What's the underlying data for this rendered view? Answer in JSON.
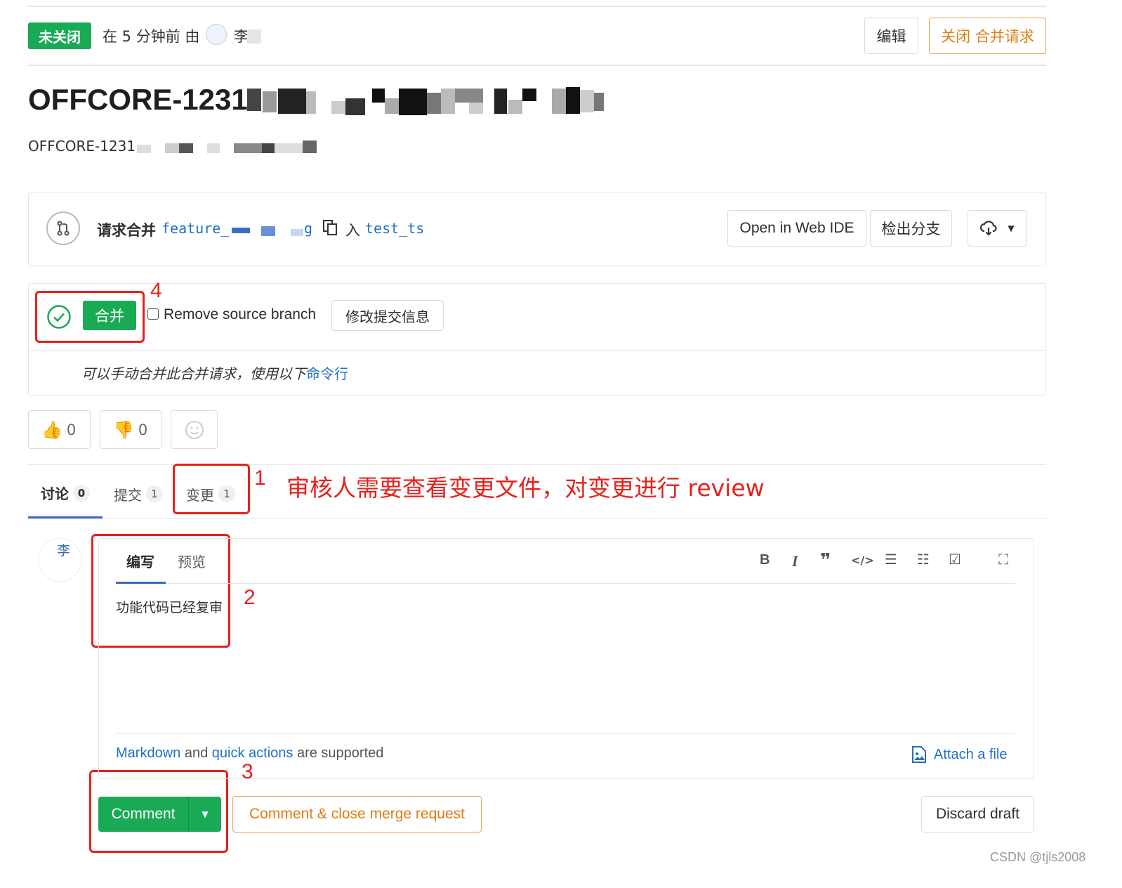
{
  "header": {
    "status_badge": "未关闭",
    "meta_text": "在 5 分钟前 由",
    "author_initial": "李",
    "edit_button": "编辑",
    "close_button": "关闭 合并请求"
  },
  "title": {
    "prefix": "OFFCORE-1231",
    "description_prefix": "OFFCORE-1231"
  },
  "branch_box": {
    "label": "请求合并",
    "source_branch_part": "feature_",
    "source_branch_end": "g",
    "into": "入",
    "target_branch": "test_ts",
    "web_ide_button": "Open in Web IDE",
    "checkout_button": "检出分支"
  },
  "merge_widget": {
    "merge_button": "合并",
    "remove_source_label": "Remove source branch",
    "modify_commit_button": "修改提交信息",
    "manual_text": "可以手动合并此合并请求，使用以下",
    "command_link": "命令行"
  },
  "reactions": {
    "thumbs_up_count": "0",
    "thumbs_down_count": "0"
  },
  "tabs": [
    {
      "label": "讨论",
      "count": "0"
    },
    {
      "label": "提交",
      "count": "1"
    },
    {
      "label": "变更",
      "count": "1"
    }
  ],
  "annotations": {
    "n1": "1",
    "n1_text": "审核人需要查看变更文件，对变更进行 review",
    "n2": "2",
    "n3": "3",
    "n4": "4"
  },
  "editor": {
    "avatar_text": "李",
    "write_tab": "编写",
    "preview_tab": "预览",
    "content": "功能代码已经复审",
    "markdown_link": "Markdown",
    "and_text": "and",
    "quick_actions_link": "quick actions",
    "supported_text": "are supported",
    "attach_file": "Attach a file",
    "toolbar_icons": [
      "bold-icon",
      "italic-icon",
      "quote-icon",
      "code-icon",
      "bullet-list-icon",
      "numbered-list-icon",
      "task-list-icon",
      "fullscreen-icon"
    ]
  },
  "actions": {
    "comment_button": "Comment",
    "comment_close_button": "Comment & close merge request",
    "discard_button": "Discard draft"
  },
  "watermark": "CSDN @tjls2008",
  "colors": {
    "green": "#1aaa55",
    "orange": "#e9a050",
    "link": "#1f70c1",
    "annotation_red": "#e8201c"
  }
}
